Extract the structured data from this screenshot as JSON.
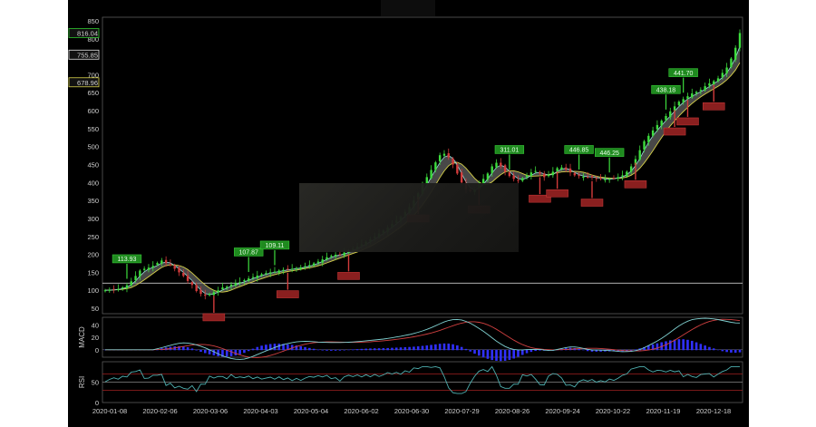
{
  "chart_data": {
    "type": "candlestick",
    "colors": {
      "background": "#000000",
      "up": "#3ddc3d",
      "down": "#d23b3b",
      "band": "#6e6e6e",
      "macd_hist": "#3030ff",
      "signal_up_label": "#1f8a1f",
      "signal_down_label": "#8a1f1f"
    },
    "price_panel": {
      "yaxis_ticks": [
        50,
        100,
        150,
        200,
        250,
        300,
        350,
        400,
        450,
        500,
        550,
        600,
        650,
        700,
        750,
        800,
        850
      ],
      "ylim": [
        35,
        860
      ],
      "last_price_labels": [
        {
          "text": "816.04",
          "color": "#2fc52f"
        },
        {
          "text": "755.85",
          "color": "#e0e0e0"
        },
        {
          "text": "678.96",
          "color": "#d8d24a"
        }
      ],
      "horizontal_line": 120,
      "buy_signals": [
        {
          "text": "113.93",
          "date_index": 5
        },
        {
          "text": "107.87",
          "date_index": 33
        },
        {
          "text": "109.11",
          "date_index": 39
        },
        {
          "text": "311.01",
          "date_index": 93
        },
        {
          "text": "446.85",
          "date_index": 109
        },
        {
          "text": "446.25",
          "date_index": 116
        },
        {
          "text": "438.18",
          "date_index": 129
        },
        {
          "text": "441.70",
          "date_index": 133
        }
      ],
      "sell_signal_count": 12,
      "closes": [
        100,
        101,
        102,
        104,
        108,
        114,
        125,
        140,
        155,
        160,
        163,
        168,
        176,
        183,
        176,
        170,
        160,
        150,
        140,
        126,
        115,
        98,
        90,
        85,
        90,
        95,
        100,
        108,
        110,
        116,
        120,
        123,
        128,
        133,
        137,
        141,
        145,
        148,
        150,
        152,
        155,
        157,
        159,
        160,
        162,
        164,
        167,
        170,
        175,
        180,
        186,
        192,
        196,
        199,
        200,
        205,
        210,
        216,
        222,
        228,
        235,
        242,
        250,
        258,
        266,
        275,
        285,
        295,
        305,
        318,
        332,
        350,
        370,
        395,
        415,
        435,
        456,
        476,
        480,
        470,
        450,
        425,
        400,
        380,
        376,
        380,
        395,
        410,
        425,
        445,
        455,
        445,
        430,
        418,
        410,
        405,
        412,
        420,
        428,
        432,
        425,
        415,
        422,
        430,
        440,
        442,
        436,
        428,
        420,
        418,
        416,
        415,
        414,
        412,
        410,
        409,
        410,
        412,
        415,
        420,
        430,
        445,
        465,
        490,
        515,
        530,
        545,
        560,
        572,
        585,
        598,
        612,
        625,
        632,
        640,
        648,
        652,
        658,
        668,
        676,
        682,
        690,
        705,
        720,
        745,
        775,
        816
      ]
    },
    "macd_panel": {
      "title": "MACD",
      "yaxis_ticks": [
        40,
        20,
        0
      ],
      "ylim": [
        -12,
        52
      ]
    },
    "rsi_panel": {
      "title": "RSI",
      "yaxis_ticks": [
        50,
        0
      ],
      "ylim": [
        0,
        100
      ],
      "levels": [
        70,
        50,
        30
      ]
    },
    "xaxis_ticks": [
      "2020-01-08",
      "2020-02-06",
      "2020-03-06",
      "2020-04-03",
      "2020-05-04",
      "2020-06-02",
      "2020-06-30",
      "2020-07-29",
      "2020-08-26",
      "2020-09-24",
      "2020-10-22",
      "2020-11-19",
      "2020-12-18"
    ]
  }
}
